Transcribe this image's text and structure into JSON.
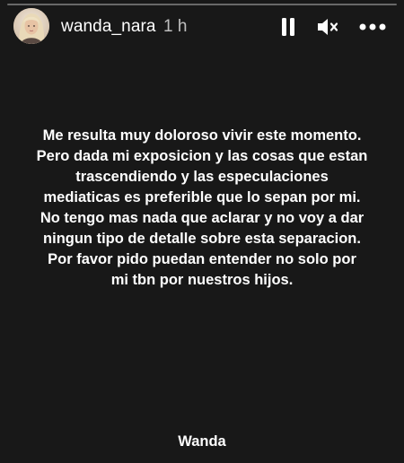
{
  "story": {
    "progress": 0.0
  },
  "header": {
    "username": "wanda_nara",
    "timestamp": "1 h",
    "avatar_icon": "profile-avatar",
    "pause_icon": "pause-icon",
    "mute_icon": "speaker-muted-icon",
    "more_icon": "more-options-icon"
  },
  "content": {
    "message": "Me resulta muy doloroso  vivir este momento.\nPero dada mi exposicion y las cosas que estan\ntrascendiendo y las especulaciones\nmediaticas es preferible que lo sepan por mi.\nNo tengo  mas nada que aclarar y no voy a dar\nningun tipo de detalle sobre esta separacion.\nPor favor pido  puedan entender no solo por\nmi  tbn por nuestros hijos.",
    "signature": "Wanda"
  },
  "colors": {
    "background": "#181818",
    "text": "#ffffff"
  }
}
